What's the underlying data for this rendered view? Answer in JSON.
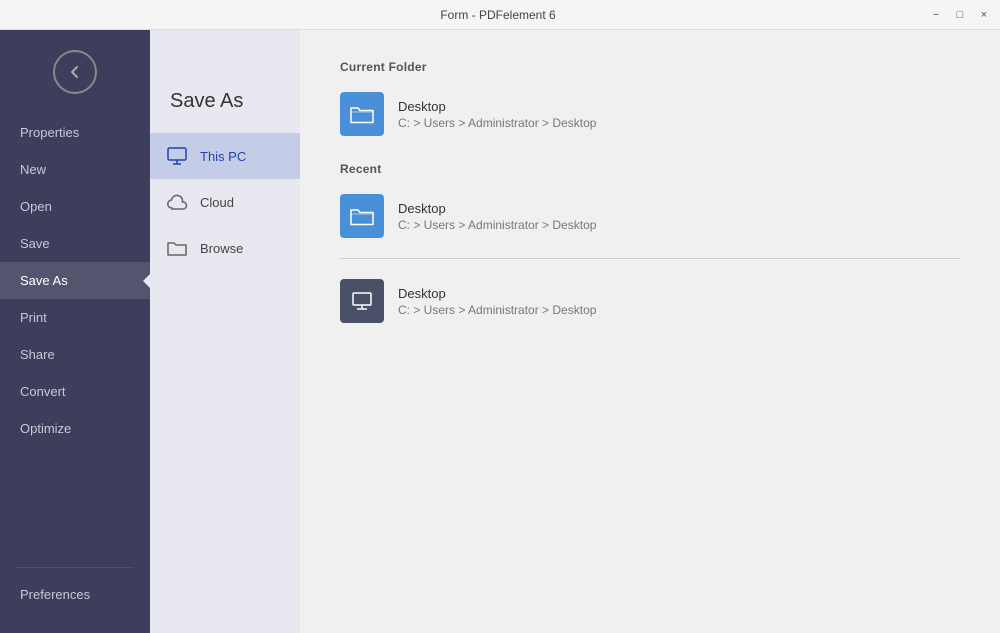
{
  "titlebar": {
    "title": "Form - PDFelement 6",
    "minimize": "−",
    "restore": "□",
    "close": "×"
  },
  "sidebar": {
    "items": [
      {
        "id": "properties",
        "label": "Properties"
      },
      {
        "id": "new",
        "label": "New"
      },
      {
        "id": "open",
        "label": "Open"
      },
      {
        "id": "save",
        "label": "Save"
      },
      {
        "id": "save-as",
        "label": "Save As",
        "active": true
      },
      {
        "id": "print",
        "label": "Print"
      },
      {
        "id": "share",
        "label": "Share"
      },
      {
        "id": "convert",
        "label": "Convert"
      },
      {
        "id": "optimize",
        "label": "Optimize"
      }
    ],
    "bottom": [
      {
        "id": "preferences",
        "label": "Preferences"
      }
    ]
  },
  "panel": {
    "title": "Save As",
    "nav_items": [
      {
        "id": "this-pc",
        "label": "This PC",
        "icon": "monitor",
        "active": true
      },
      {
        "id": "cloud",
        "label": "Cloud",
        "icon": "cloud"
      },
      {
        "id": "browse",
        "label": "Browse",
        "icon": "folder"
      }
    ]
  },
  "content": {
    "current_folder_label": "Current Folder",
    "recent_label": "Recent",
    "current_folder": {
      "name": "Desktop",
      "path": "C: > Users > Administrator > Desktop"
    },
    "recent_items": [
      {
        "name": "Desktop",
        "path": "C: > Users > Administrator > Desktop",
        "icon": "blue"
      },
      {
        "name": "Desktop",
        "path": "C: > Users > Administrator > Desktop",
        "icon": "dark"
      }
    ]
  }
}
